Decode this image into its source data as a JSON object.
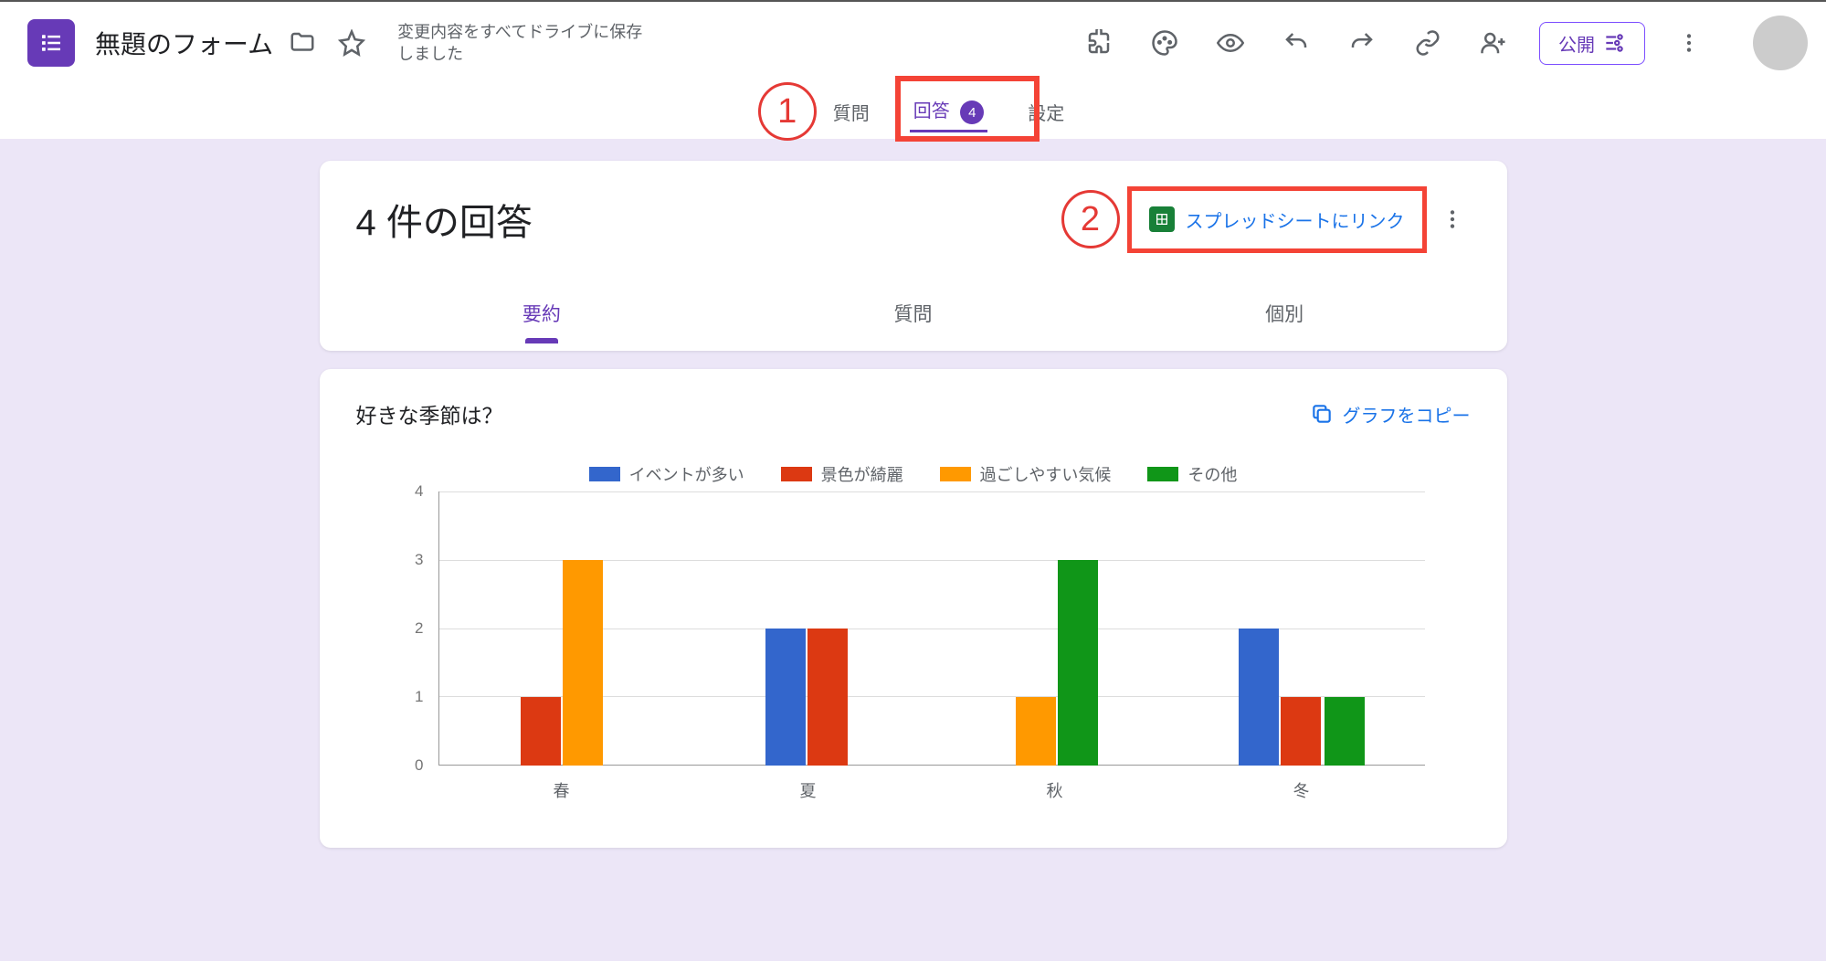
{
  "header": {
    "form_title": "無題のフォーム",
    "save_status": "変更内容をすべてドライブに保存しました",
    "publish_label": "公開"
  },
  "annotations": {
    "one": "1",
    "two": "2"
  },
  "nav": {
    "tabs": {
      "questions": "質問",
      "responses": "回答",
      "responses_count": "4",
      "settings": "設定"
    }
  },
  "responses_card": {
    "title": "4 件の回答",
    "sheets_link_label": "スプレッドシートにリンク",
    "subtabs": {
      "summary": "要約",
      "question": "質問",
      "individual": "個別"
    }
  },
  "chart_card": {
    "question": "好きな季節は？",
    "copy_label": "グラフをコピー"
  },
  "chart_data": {
    "type": "bar",
    "title": "好きな季節は？",
    "xlabel": "",
    "ylabel": "",
    "ylim": [
      0,
      4
    ],
    "y_ticks": [
      0,
      1,
      2,
      3,
      4
    ],
    "categories": [
      "春",
      "夏",
      "秋",
      "冬"
    ],
    "series": [
      {
        "name": "イベントが多い",
        "color": "#3366cc",
        "values": [
          0,
          2,
          0,
          2
        ]
      },
      {
        "name": "景色が綺麗",
        "color": "#dc3912",
        "values": [
          1,
          2,
          0,
          1
        ]
      },
      {
        "name": "過ごしやすい気候",
        "color": "#ff9900",
        "values": [
          3,
          0,
          1,
          0
        ]
      },
      {
        "name": "その他",
        "color": "#109618",
        "values": [
          0,
          0,
          3,
          1
        ]
      }
    ]
  }
}
